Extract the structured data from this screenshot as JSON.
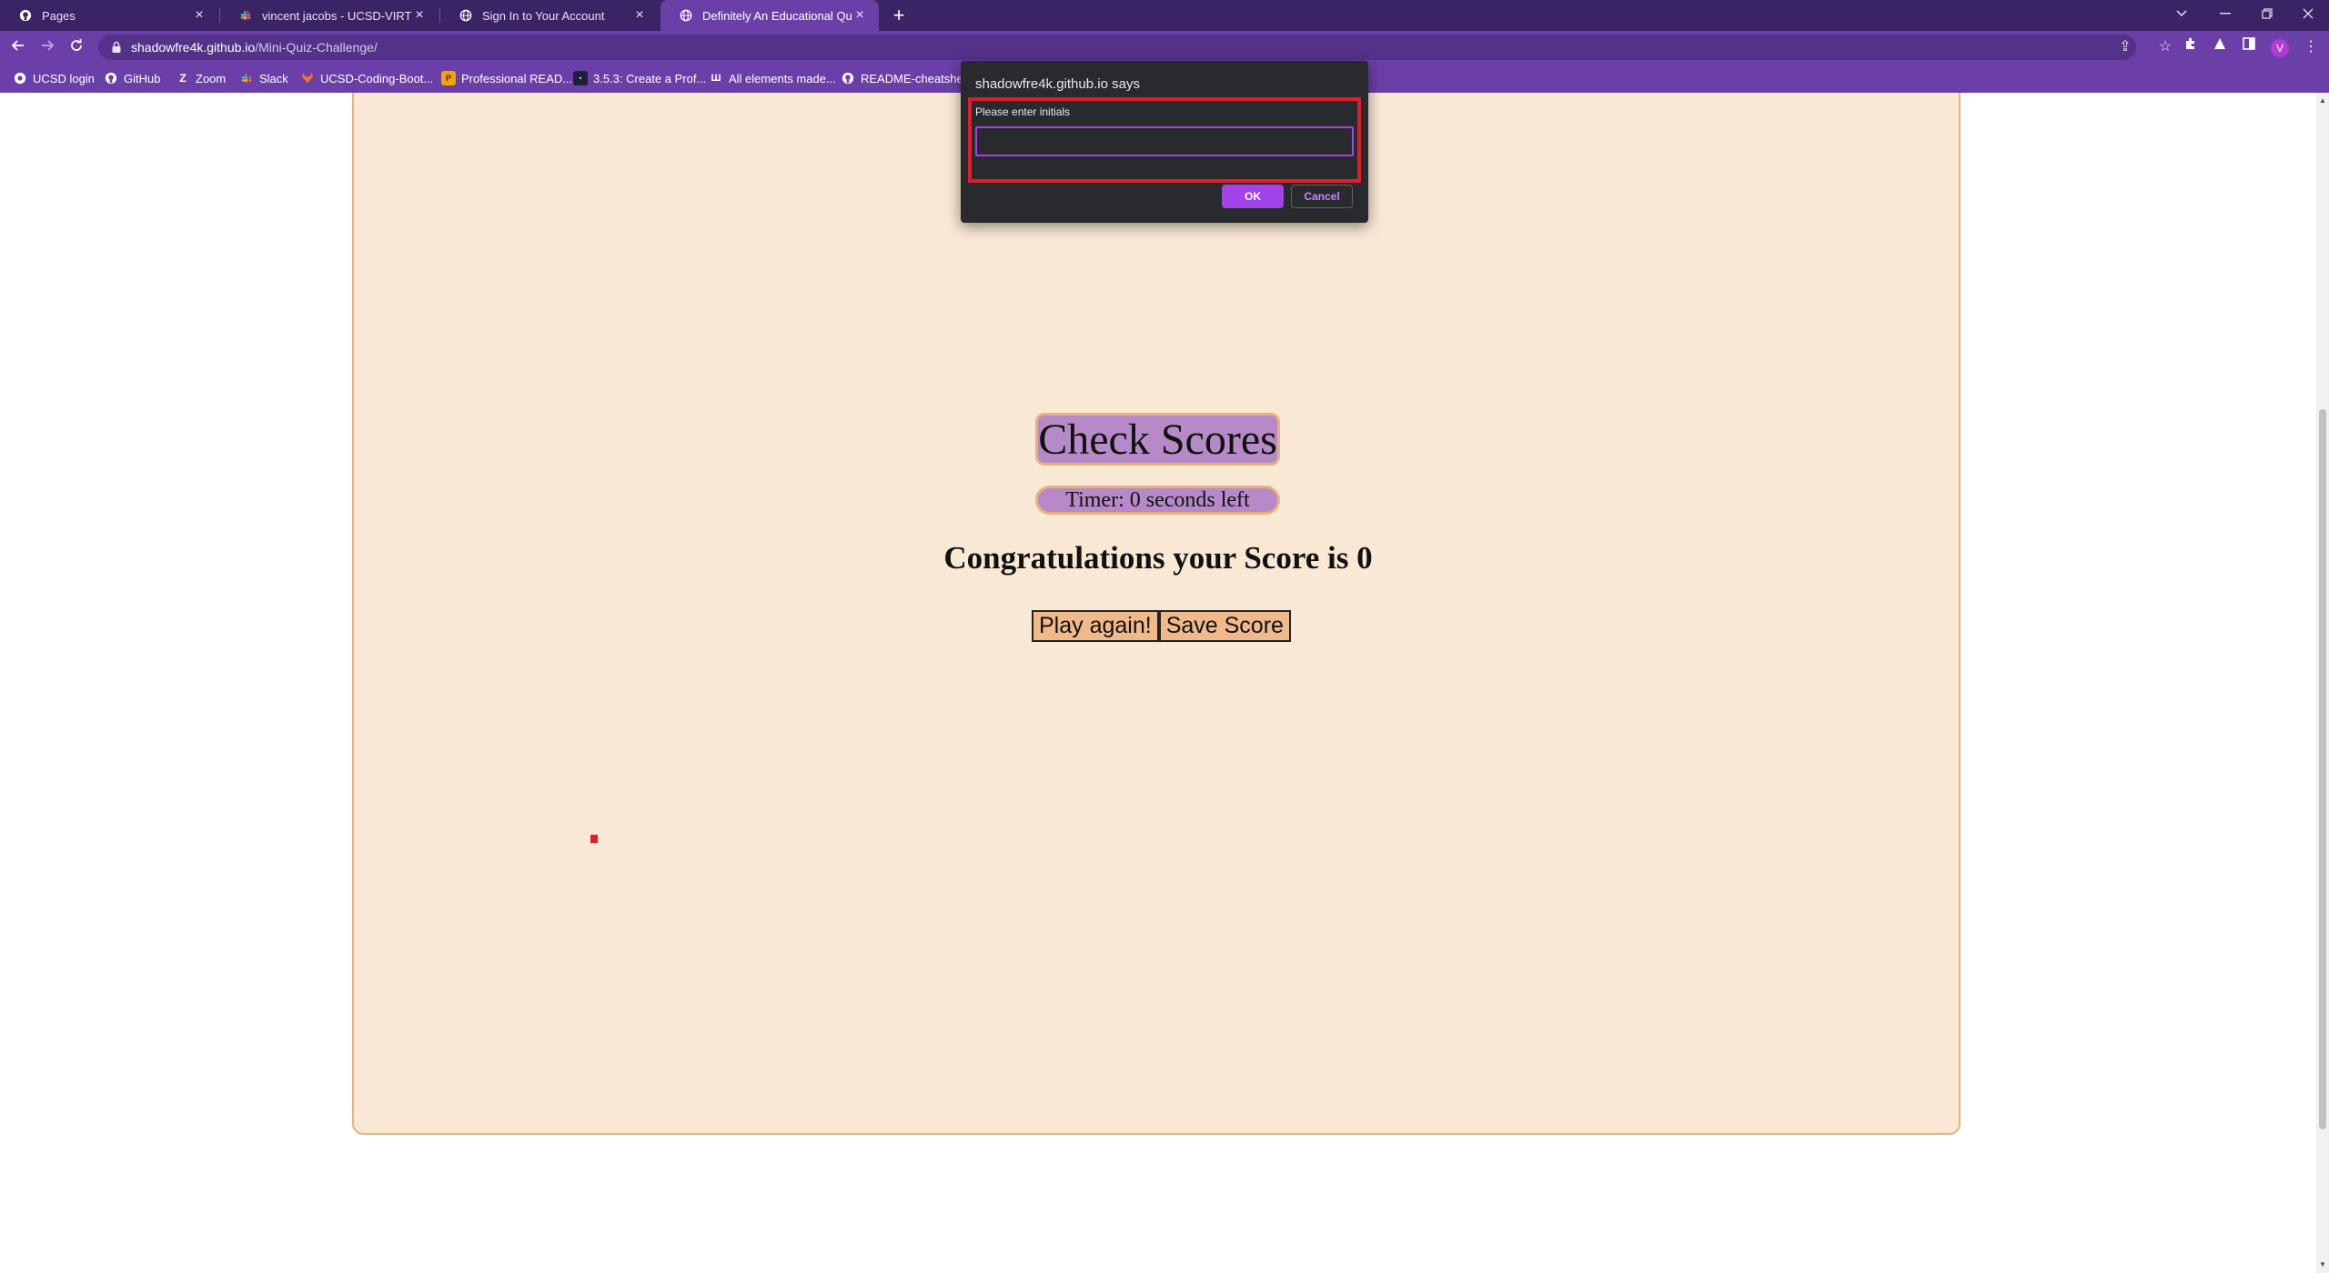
{
  "browser": {
    "tabs": [
      {
        "title": "Pages",
        "icon": "github-icon"
      },
      {
        "title": "vincent jacobs - UCSD-VIRT-FSF",
        "icon": "slack-icon"
      },
      {
        "title": "Sign In to Your Account",
        "icon": "globe-icon"
      },
      {
        "title": "Definitely An Educational Quiz",
        "icon": "globe-icon",
        "active": true
      }
    ],
    "url_host": "shadowfre4k.github.io",
    "url_path": "/Mini-Quiz-Challenge/",
    "profile_initial": "V",
    "bookmarks": [
      {
        "label": "UCSD login",
        "icon": "ucsd-icon"
      },
      {
        "label": "GitHub",
        "icon": "github-icon"
      },
      {
        "label": "Zoom",
        "icon": "zoom-icon"
      },
      {
        "label": "Slack",
        "icon": "slack-icon"
      },
      {
        "label": "UCSD-Coding-Boot...",
        "icon": "gitlab-icon"
      },
      {
        "label": "Professional READ...",
        "icon": "readme-icon"
      },
      {
        "label": "3.5.3: Create a Prof...",
        "icon": "course-icon"
      },
      {
        "label": "All elements made...",
        "icon": "mdn-icon"
      },
      {
        "label": "README-cheatshee...",
        "icon": "github-icon"
      }
    ]
  },
  "page": {
    "check_scores_label": "Check Scores",
    "timer_text": "Timer: 0 seconds left",
    "score_message": "Congratulations your Score is 0",
    "play_again_label": "Play again!",
    "save_score_label": "Save Score"
  },
  "dialog": {
    "title": "shadowfre4k.github.io says",
    "message": "Please enter initials",
    "input_value": "",
    "ok_label": "OK",
    "cancel_label": "Cancel"
  },
  "colors": {
    "tabstrip": "#3b2466",
    "toolbar": "#6b3fa8",
    "card_bg": "#f9e8d4",
    "card_border": "#e7b27a",
    "purple_button": "#b68ac8",
    "dialog_bg": "#292a2d",
    "dialog_accent": "#a143e8",
    "highlight_red": "#e01d2c"
  }
}
